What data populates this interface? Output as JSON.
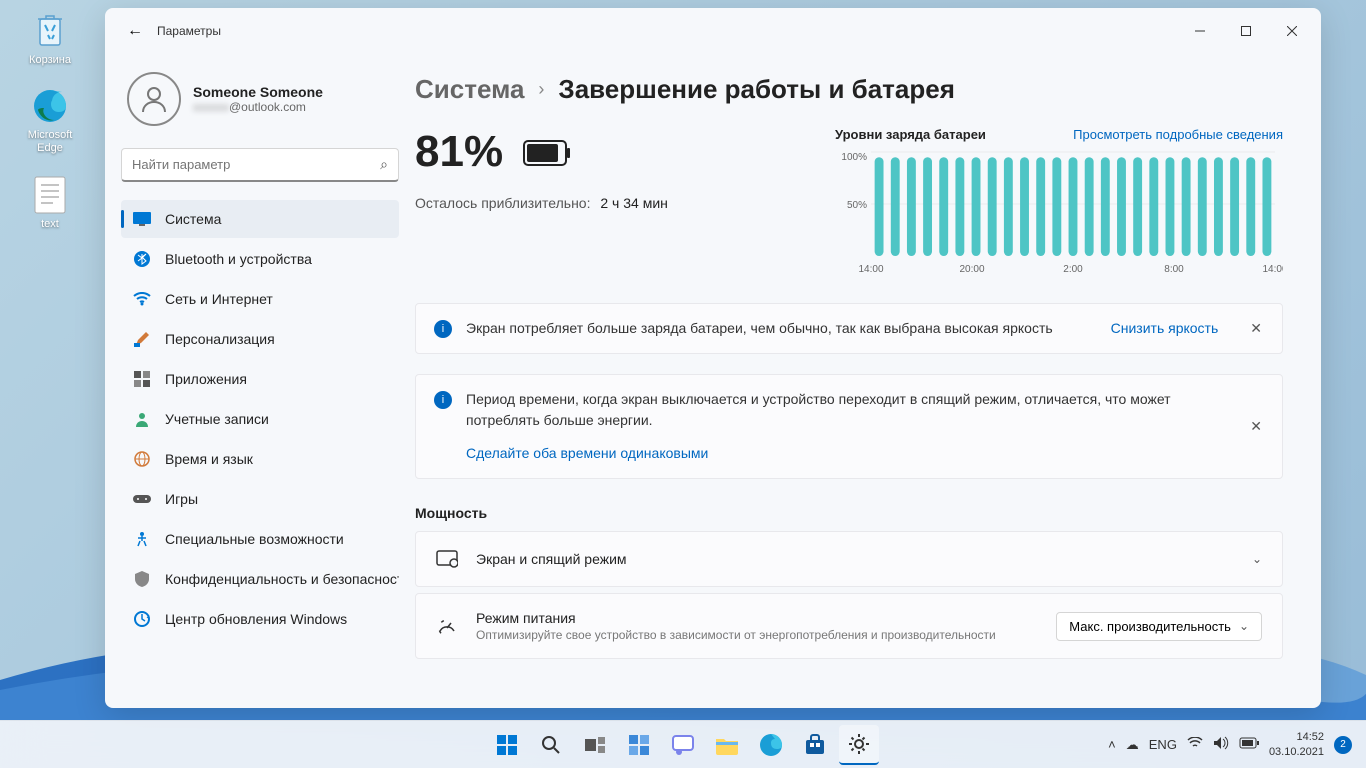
{
  "desktop": {
    "icons": [
      {
        "name": "recycle-bin",
        "label": "Корзина"
      },
      {
        "name": "edge",
        "label": "Microsoft Edge"
      },
      {
        "name": "text-file",
        "label": "text"
      }
    ]
  },
  "window": {
    "app_title": "Параметры",
    "user": {
      "name": "Someone Someone",
      "email": "@outlook.com"
    },
    "search_placeholder": "Найти параметр",
    "nav": [
      {
        "key": "system",
        "label": "Система",
        "active": true
      },
      {
        "key": "bluetooth",
        "label": "Bluetooth и устройства"
      },
      {
        "key": "network",
        "label": "Сеть и Интернет"
      },
      {
        "key": "personalization",
        "label": "Персонализация"
      },
      {
        "key": "apps",
        "label": "Приложения"
      },
      {
        "key": "accounts",
        "label": "Учетные записи"
      },
      {
        "key": "time",
        "label": "Время и язык"
      },
      {
        "key": "gaming",
        "label": "Игры"
      },
      {
        "key": "accessibility",
        "label": "Специальные возможности"
      },
      {
        "key": "privacy",
        "label": "Конфиденциальность и безопасность"
      },
      {
        "key": "update",
        "label": "Центр обновления Windows"
      }
    ],
    "breadcrumb": {
      "root": "Система",
      "current": "Завершение работы и батарея"
    },
    "battery": {
      "percent": "81%",
      "time_left_label": "Осталось приблизительно:",
      "time_left_value": "2 ч 34 мин"
    },
    "chart": {
      "title": "Уровни заряда батареи",
      "details_link": "Просмотреть подробные сведения"
    },
    "info1": {
      "text": "Экран потребляет больше заряда батареи, чем обычно, так как выбрана высокая яркость",
      "action": "Снизить яркость"
    },
    "info2": {
      "text": "Период времени, когда экран выключается и устройство переходит в спящий режим, отличается, что может потреблять больше энергии.",
      "link": "Сделайте оба времени одинаковыми"
    },
    "power": {
      "section_title": "Мощность",
      "row_screen": {
        "title": "Экран и спящий режим"
      },
      "row_mode": {
        "title": "Режим питания",
        "sub": "Оптимизируйте свое устройство в зависимости от энергопотребления и производительности",
        "value": "Макс. производительность"
      }
    }
  },
  "taskbar": {
    "lang": "ENG",
    "time": "14:52",
    "date": "03.10.2021",
    "notif_count": "2"
  },
  "chart_data": {
    "type": "bar",
    "title": "Уровни заряда батареи",
    "ylabel": "%",
    "ylim": [
      0,
      100
    ],
    "y_ticks": [
      "100%",
      "50%"
    ],
    "x_ticks": [
      "14:00",
      "20:00",
      "2:00",
      "8:00",
      "14:00"
    ],
    "x": [
      "14:00",
      "15:00",
      "16:00",
      "17:00",
      "18:00",
      "19:00",
      "20:00",
      "21:00",
      "22:00",
      "23:00",
      "00:00",
      "01:00",
      "02:00",
      "03:00",
      "04:00",
      "05:00",
      "06:00",
      "07:00",
      "08:00",
      "09:00",
      "10:00",
      "11:00",
      "12:00",
      "13:00",
      "14:00"
    ],
    "values": [
      95,
      95,
      95,
      95,
      95,
      95,
      95,
      95,
      95,
      95,
      95,
      95,
      95,
      95,
      95,
      95,
      95,
      95,
      95,
      95,
      95,
      95,
      95,
      95,
      95
    ]
  }
}
